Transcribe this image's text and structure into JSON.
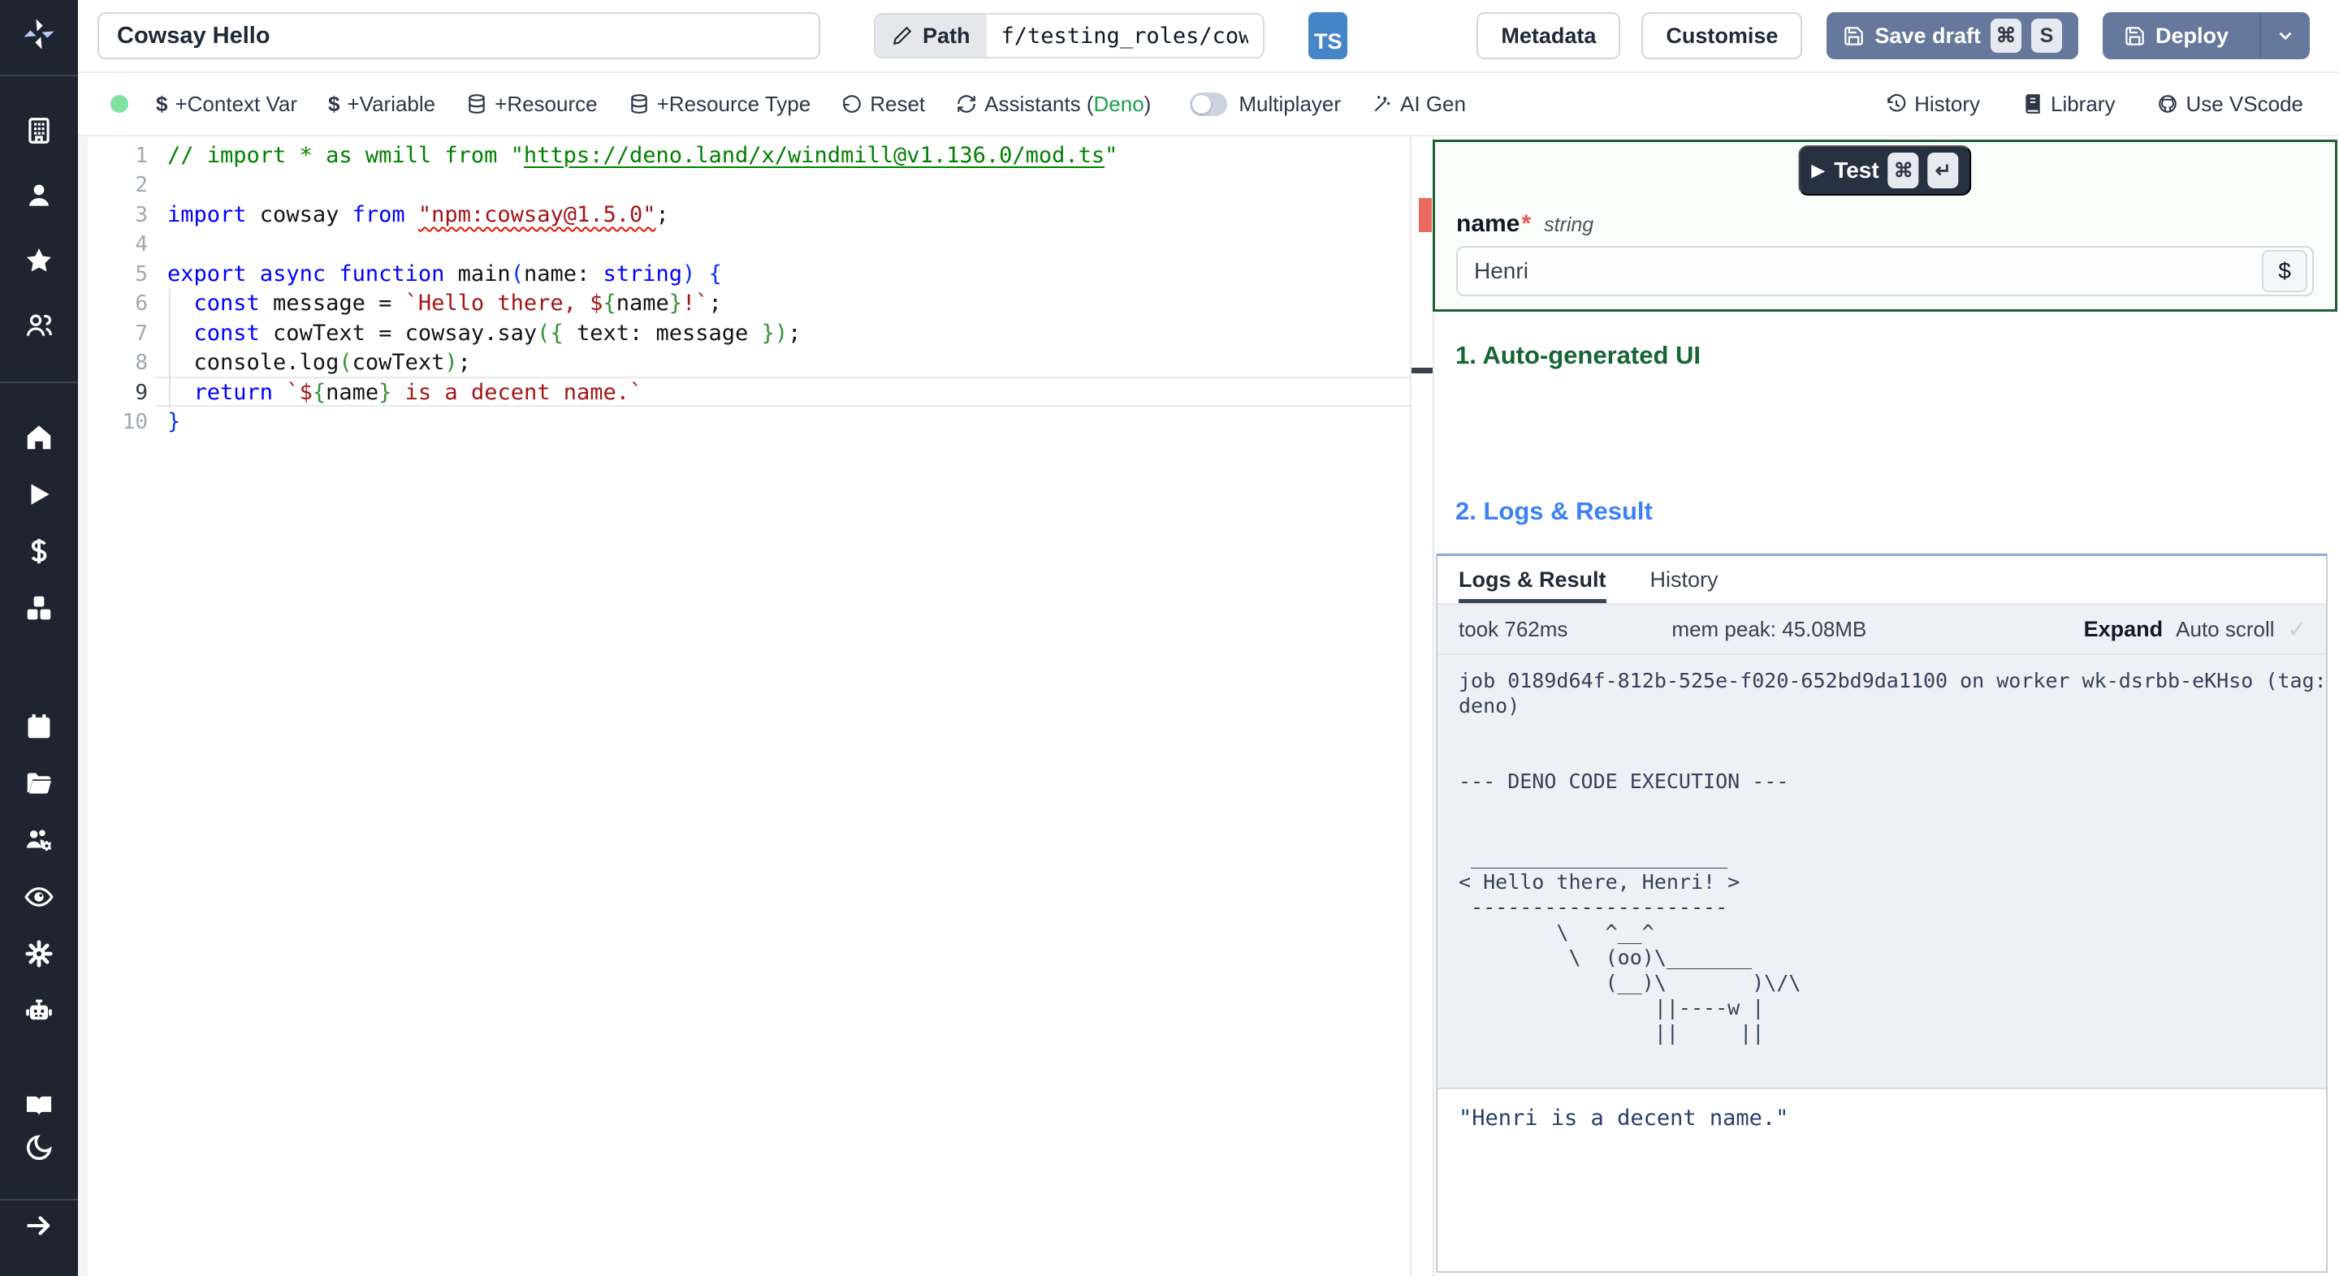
{
  "header": {
    "title_value": "Cowsay Hello",
    "path_label": "Path",
    "path_value": "f/testing_roles/cowsa",
    "lang_badge": "TS",
    "metadata_label": "Metadata",
    "customise_label": "Customise",
    "save_draft_label": "Save draft",
    "shortcut_mod": "⌘",
    "shortcut_key": "S",
    "deploy_label": "Deploy"
  },
  "toolbar": {
    "context_var": "+Context Var",
    "variable": "+Variable",
    "resource": "+Resource",
    "resource_type": "+Resource Type",
    "reset": "Reset",
    "assistants_prefix": "Assistants (",
    "assistants_lang": "Deno",
    "assistants_suffix": ")",
    "multiplayer": "Multiplayer",
    "ai_gen": "AI Gen",
    "history": "History",
    "library": "Library",
    "use_vscode": "Use VScode"
  },
  "editor": {
    "active_line": 9,
    "lines": [
      [
        [
          "cm",
          "// import * as wmill from \""
        ],
        [
          "cl",
          "https://deno.land/x/windmill@v1.136.0/mod.ts"
        ],
        [
          "cm",
          "\""
        ]
      ],
      [],
      [
        [
          "kw",
          "import"
        ],
        [
          "pl",
          " cowsay "
        ],
        [
          "kw",
          "from"
        ],
        [
          "pl",
          " "
        ],
        [
          "serr",
          "\"npm:cowsay@1.5.0\""
        ],
        [
          "pl",
          ";"
        ]
      ],
      [],
      [
        [
          "kw",
          "export"
        ],
        [
          "pl",
          " "
        ],
        [
          "kw",
          "async"
        ],
        [
          "pl",
          " "
        ],
        [
          "kw",
          "function"
        ],
        [
          "pl",
          " main"
        ],
        [
          "bb",
          "("
        ],
        [
          "pl",
          "name: "
        ],
        [
          "kw",
          "string"
        ],
        [
          "bb",
          ")"
        ],
        [
          "pl",
          " "
        ],
        [
          "bb",
          "{"
        ]
      ],
      [
        [
          "pl",
          "  "
        ],
        [
          "kw",
          "const"
        ],
        [
          "pl",
          " message = "
        ],
        [
          "str",
          "`Hello there, $"
        ],
        [
          "bg",
          "{"
        ],
        [
          "pl",
          "name"
        ],
        [
          "bg",
          "}"
        ],
        [
          "str",
          "!`"
        ],
        [
          "pl",
          ";"
        ]
      ],
      [
        [
          "pl",
          "  "
        ],
        [
          "kw",
          "const"
        ],
        [
          "pl",
          " cowText = cowsay.say"
        ],
        [
          "bg",
          "("
        ],
        [
          "bg",
          "{"
        ],
        [
          "pl",
          " text: message "
        ],
        [
          "bg",
          "}"
        ],
        [
          "bg",
          ")"
        ],
        [
          "pl",
          ";"
        ]
      ],
      [
        [
          "pl",
          "  console.log"
        ],
        [
          "bg",
          "("
        ],
        [
          "pl",
          "cowText"
        ],
        [
          "bg",
          ")"
        ],
        [
          "pl",
          ";"
        ]
      ],
      [
        [
          "pl",
          "  "
        ],
        [
          "kw",
          "return"
        ],
        [
          "pl",
          " "
        ],
        [
          "str",
          "`$"
        ],
        [
          "bg",
          "{"
        ],
        [
          "pl",
          "name"
        ],
        [
          "bg",
          "}"
        ],
        [
          "str",
          " is a decent name.`"
        ]
      ],
      [
        [
          "bb",
          "}"
        ]
      ]
    ]
  },
  "form": {
    "test_label": "Test",
    "test_mod": "⌘",
    "test_enter": "↵",
    "field_name": "name",
    "required_mark": "*",
    "field_type": "string",
    "field_value": "Henri",
    "dollar_label": "$"
  },
  "sections": {
    "auto_ui": "1. Auto-generated UI",
    "logs_result": "2. Logs & Result"
  },
  "logs": {
    "tab_logs": "Logs & Result",
    "tab_history": "History",
    "took": "took 762ms",
    "mem_peak": "mem peak: 45.08MB",
    "expand": "Expand",
    "autoscroll": "Auto scroll",
    "check": "✓",
    "text": "job 0189d64f-812b-525e-f020-652bd9da1100 on worker wk-dsrbb-eKHso (tag:\ndeno)\n\n\n--- DENO CODE EXECUTION ---\n\n\n _____________________\n< Hello there, Henri! >\n ---------------------\n        \\   ^__^\n         \\  (oo)\\_______\n            (__)\\       )\\/\\\n                ||----w |\n                ||     ||",
    "result_value": "\"Henri is a decent name.\""
  },
  "sidebar": {
    "logo": "windmill-logo",
    "group_workspace": [
      "building",
      "user",
      "star",
      "user-group"
    ],
    "group_main": [
      "home",
      "play",
      "dollar",
      "cubes"
    ],
    "group_tools": [
      "calendar",
      "folder",
      "users-gear",
      "eye",
      "gear",
      "robot"
    ],
    "group_footer": [
      "book-open",
      "moon"
    ],
    "expand": "arrow-right"
  },
  "colors": {
    "rail_bg": "#1f2530",
    "slate_button": "#66789b",
    "ts_blue": "#4585c8",
    "form_border_green": "#1e5f31",
    "heading_green": "#166534",
    "heading_blue": "#3c82f6",
    "status_dot_green": "#7fe3a0",
    "error_red": "#e51400",
    "overview_error": "#eb6a5f"
  }
}
